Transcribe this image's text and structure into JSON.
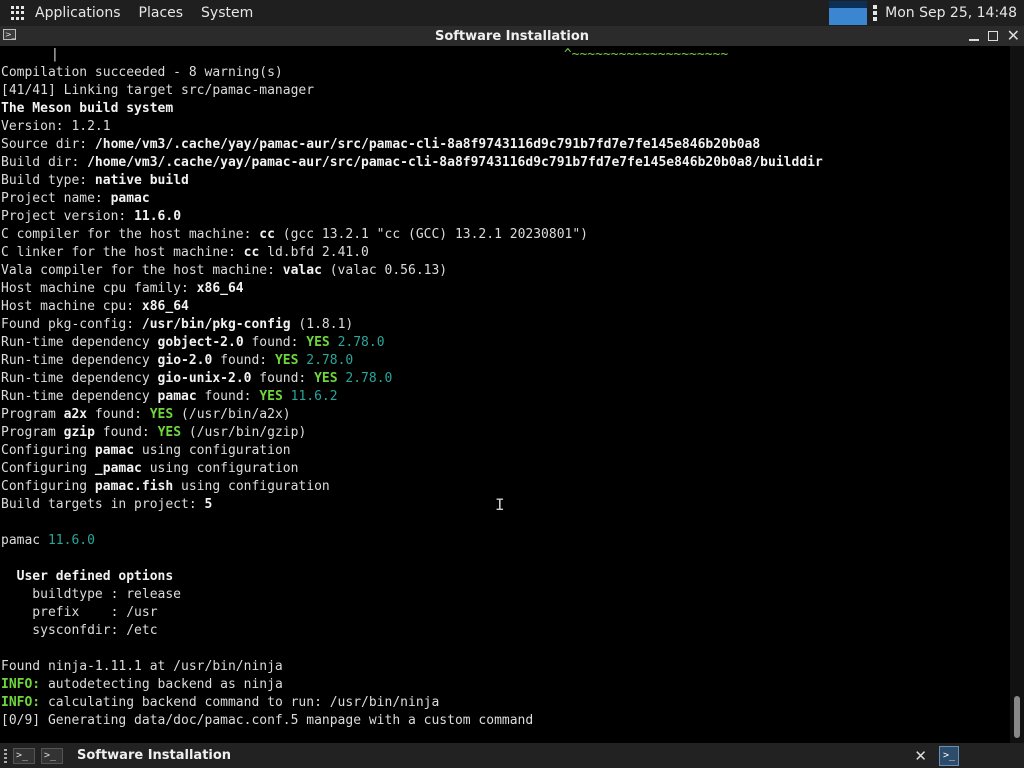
{
  "top_panel": {
    "menus": [
      "Applications",
      "Places",
      "System"
    ],
    "clock": "Mon Sep 25, 14:48",
    "monitor_level": 0.7
  },
  "window": {
    "title": "Software Installation"
  },
  "terminal": {
    "top_marker": "|",
    "top_tildes": "^~~~~~~~~~~~~~~~~~~~~",
    "lines": [
      [
        [
          "Compilation succeeded - 8 warning(s)",
          "n"
        ]
      ],
      [
        [
          "[41/41] Linking target src/pamac-manager",
          "n"
        ]
      ],
      [
        [
          "The Meson build system",
          "b"
        ]
      ],
      [
        [
          "Version: 1.2.1",
          "n"
        ]
      ],
      [
        [
          "Source dir: ",
          "n"
        ],
        [
          "/home/vm3/.cache/yay/pamac-aur/src/pamac-cli-8a8f9743116d9c791b7fd7e7fe145e846b20b0a8",
          "b"
        ]
      ],
      [
        [
          "Build dir: ",
          "n"
        ],
        [
          "/home/vm3/.cache/yay/pamac-aur/src/pamac-cli-8a8f9743116d9c791b7fd7e7fe145e846b20b0a8/builddir",
          "b"
        ]
      ],
      [
        [
          "Build type: ",
          "n"
        ],
        [
          "native build",
          "b"
        ]
      ],
      [
        [
          "Project name: ",
          "n"
        ],
        [
          "pamac",
          "b"
        ]
      ],
      [
        [
          "Project version: ",
          "n"
        ],
        [
          "11.6.0",
          "b"
        ]
      ],
      [
        [
          "C compiler for the host machine: ",
          "n"
        ],
        [
          "cc",
          "b"
        ],
        [
          " (gcc 13.2.1 \"cc (GCC) 13.2.1 20230801\")",
          "n"
        ]
      ],
      [
        [
          "C linker for the host machine: ",
          "n"
        ],
        [
          "cc",
          "b"
        ],
        [
          " ld.bfd 2.41.0",
          "n"
        ]
      ],
      [
        [
          "Vala compiler for the host machine: ",
          "n"
        ],
        [
          "valac",
          "b"
        ],
        [
          " (valac 0.56.13)",
          "n"
        ]
      ],
      [
        [
          "Host machine cpu family: ",
          "n"
        ],
        [
          "x86_64",
          "b"
        ]
      ],
      [
        [
          "Host machine cpu: ",
          "n"
        ],
        [
          "x86_64",
          "b"
        ]
      ],
      [
        [
          "Found pkg-config: ",
          "n"
        ],
        [
          "/usr/bin/pkg-config",
          "b"
        ],
        [
          " (1.8.1)",
          "n"
        ]
      ],
      [
        [
          "Run-time dependency ",
          "n"
        ],
        [
          "gobject-2.0",
          "b"
        ],
        [
          " found: ",
          "n"
        ],
        [
          "YES",
          "yes"
        ],
        [
          " 2.78.0",
          "ver"
        ]
      ],
      [
        [
          "Run-time dependency ",
          "n"
        ],
        [
          "gio-2.0",
          "b"
        ],
        [
          " found: ",
          "n"
        ],
        [
          "YES",
          "yes"
        ],
        [
          " 2.78.0",
          "ver"
        ]
      ],
      [
        [
          "Run-time dependency ",
          "n"
        ],
        [
          "gio-unix-2.0",
          "b"
        ],
        [
          " found: ",
          "n"
        ],
        [
          "YES",
          "yes"
        ],
        [
          " 2.78.0",
          "ver"
        ]
      ],
      [
        [
          "Run-time dependency ",
          "n"
        ],
        [
          "pamac",
          "b"
        ],
        [
          " found: ",
          "n"
        ],
        [
          "YES",
          "yes"
        ],
        [
          " 11.6.2",
          "ver"
        ]
      ],
      [
        [
          "Program ",
          "n"
        ],
        [
          "a2x",
          "b"
        ],
        [
          " found: ",
          "n"
        ],
        [
          "YES",
          "yes"
        ],
        [
          " (/usr/bin/a2x)",
          "n"
        ]
      ],
      [
        [
          "Program ",
          "n"
        ],
        [
          "gzip",
          "b"
        ],
        [
          " found: ",
          "n"
        ],
        [
          "YES",
          "yes"
        ],
        [
          " (/usr/bin/gzip)",
          "n"
        ]
      ],
      [
        [
          "Configuring ",
          "n"
        ],
        [
          "pamac",
          "b"
        ],
        [
          " using configuration",
          "n"
        ]
      ],
      [
        [
          "Configuring ",
          "n"
        ],
        [
          "_pamac",
          "b"
        ],
        [
          " using configuration",
          "n"
        ]
      ],
      [
        [
          "Configuring ",
          "n"
        ],
        [
          "pamac.fish",
          "b"
        ],
        [
          " using configuration",
          "n"
        ]
      ],
      [
        [
          "Build targets in project: ",
          "n"
        ],
        [
          "5",
          "b"
        ]
      ],
      [
        [
          "",
          "n"
        ]
      ],
      [
        [
          "pamac ",
          "n"
        ],
        [
          "11.6.0",
          "ver"
        ]
      ],
      [
        [
          "",
          "n"
        ]
      ],
      [
        [
          "  User defined options",
          "b"
        ]
      ],
      [
        [
          "    buildtype : release",
          "n"
        ]
      ],
      [
        [
          "    prefix    : /usr",
          "n"
        ]
      ],
      [
        [
          "    sysconfdir: /etc",
          "n"
        ]
      ],
      [
        [
          "",
          "n"
        ]
      ],
      [
        [
          "Found ninja-1.11.1 at /usr/bin/ninja",
          "n"
        ]
      ],
      [
        [
          "INFO:",
          "info"
        ],
        [
          " autodetecting backend as ninja",
          "n"
        ]
      ],
      [
        [
          "INFO:",
          "info"
        ],
        [
          " calculating backend command to run: /usr/bin/ninja",
          "n"
        ]
      ],
      [
        [
          "[0/9] Generating data/doc/pamac.conf.5 manpage with a custom command",
          "n"
        ]
      ]
    ]
  },
  "taskbar": {
    "task_label": "Software Installation"
  },
  "colors": {
    "yes": "#6fd63b",
    "version": "#2aa59a",
    "panel": "#1f1f1f"
  }
}
